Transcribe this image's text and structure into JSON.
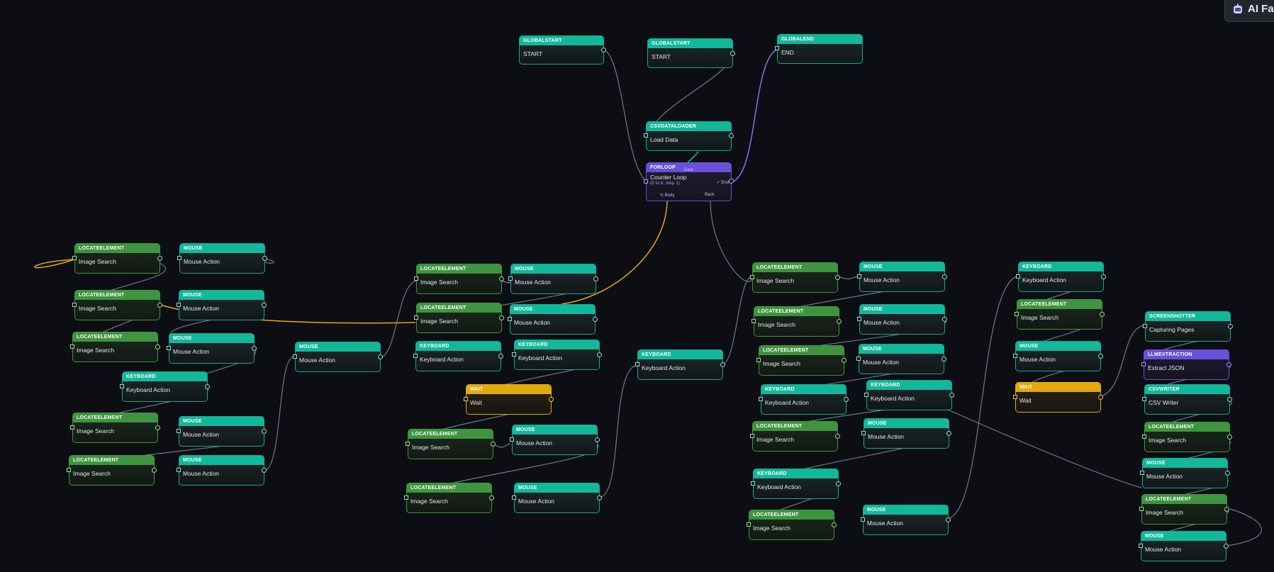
{
  "brand": {
    "title": "AI Fal"
  },
  "colors": {
    "teal": "#12b89a",
    "green": "#3f9440",
    "yellow": "#e2aa0c",
    "purple": "#6a4fd8",
    "background": "#0c0e14"
  },
  "nodes": {
    "globalstart1": {
      "type": "GLOBALSTART",
      "label": "START"
    },
    "globalstart2": {
      "type": "GLOBALSTART",
      "label": "START"
    },
    "globalend": {
      "type": "GLOBALEND",
      "label": "END"
    },
    "csvloader": {
      "type": "CSVDATALOADER",
      "label": "Load Data"
    },
    "forloop": {
      "type": "FORLOOP",
      "label": "Counter Loop",
      "detail": "(0 to 8, step 1)",
      "data_label": "Data",
      "end_label": "✓ End",
      "body_label": "↻ Body",
      "back_label": "Back"
    },
    "l1": {
      "type": "LOCATEELEMENT",
      "label": "Image Search"
    },
    "m1": {
      "type": "MOUSE",
      "label": "Mouse Action"
    },
    "l2": {
      "type": "LOCATEELEMENT",
      "label": "Image Search"
    },
    "m2": {
      "type": "MOUSE",
      "label": "Mouse Action"
    },
    "l3": {
      "type": "LOCATEELEMENT",
      "label": "Image Search"
    },
    "m3": {
      "type": "MOUSE",
      "label": "Mouse Action"
    },
    "k1": {
      "type": "KEYBOARD",
      "label": "Keyboard Action"
    },
    "l4": {
      "type": "LOCATEELEMENT",
      "label": "Image Search"
    },
    "m4": {
      "type": "MOUSE",
      "label": "Mouse Action"
    },
    "l5": {
      "type": "LOCATEELEMENT",
      "label": "Image Search"
    },
    "m5": {
      "type": "MOUSE",
      "label": "Mouse Action"
    },
    "m6": {
      "type": "MOUSE",
      "label": "Mouse Action"
    },
    "l6": {
      "type": "LOCATEELEMENT",
      "label": "Image Search"
    },
    "m7": {
      "type": "MOUSE",
      "label": "Mouse Action"
    },
    "l7": {
      "type": "LOCATEELEMENT",
      "label": "Image Search"
    },
    "m8": {
      "type": "MOUSE",
      "label": "Mouse Action"
    },
    "k2": {
      "type": "KEYBOARD",
      "label": "Keyboard Action"
    },
    "k3": {
      "type": "KEYBOARD",
      "label": "Keyboard Action"
    },
    "w1": {
      "type": "WAIT",
      "label": "Wait"
    },
    "l8": {
      "type": "LOCATEELEMENT",
      "label": "Image Search"
    },
    "m9": {
      "type": "MOUSE",
      "label": "Mouse Action"
    },
    "l9": {
      "type": "LOCATEELEMENT",
      "label": "Image Search"
    },
    "m10": {
      "type": "MOUSE",
      "label": "Mouse Action"
    },
    "k4": {
      "type": "KEYBOARD",
      "label": "Keyboard Action"
    },
    "l10": {
      "type": "LOCATEELEMENT",
      "label": "Image Search"
    },
    "m11": {
      "type": "MOUSE",
      "label": "Mouse Action"
    },
    "l11": {
      "type": "LOCATEELEMENT",
      "label": "Image Search"
    },
    "m12": {
      "type": "MOUSE",
      "label": "Mouse Action"
    },
    "l12": {
      "type": "LOCATEELEMENT",
      "label": "Image Search"
    },
    "m13": {
      "type": "MOUSE",
      "label": "Mouse Action"
    },
    "k5": {
      "type": "KEYBOARD",
      "label": "Keyboard Action"
    },
    "k6": {
      "type": "KEYBOARD",
      "label": "Keyboard Action"
    },
    "l13": {
      "type": "LOCATEELEMENT",
      "label": "Image Search"
    },
    "m14": {
      "type": "MOUSE",
      "label": "Mouse Action"
    },
    "k7": {
      "type": "KEYBOARD",
      "label": "Keyboard Action"
    },
    "l14": {
      "type": "LOCATEELEMENT",
      "label": "Image Search"
    },
    "m15": {
      "type": "MOUSE",
      "label": "Mouse Action"
    },
    "k8": {
      "type": "KEYBOARD",
      "label": "Keyboard Action"
    },
    "l15": {
      "type": "LOCATEELEMENT",
      "label": "Image Search"
    },
    "m16": {
      "type": "MOUSE",
      "label": "Mouse Action"
    },
    "w2": {
      "type": "WAIT",
      "label": "Wait"
    },
    "shot": {
      "type": "SCREENSHOTTER",
      "label": "Capturing Pages"
    },
    "llm": {
      "type": "LLMEXTRACTION",
      "label": "Extract JSON"
    },
    "csvw": {
      "type": "CSVWRITER",
      "label": "CSV Writer"
    },
    "l16": {
      "type": "LOCATEELEMENT",
      "label": "Image Search"
    },
    "m17": {
      "type": "MOUSE",
      "label": "Mouse Action"
    },
    "l17": {
      "type": "LOCATEELEMENT",
      "label": "Image Search"
    },
    "m18": {
      "type": "MOUSE",
      "label": "Mouse Action"
    }
  }
}
